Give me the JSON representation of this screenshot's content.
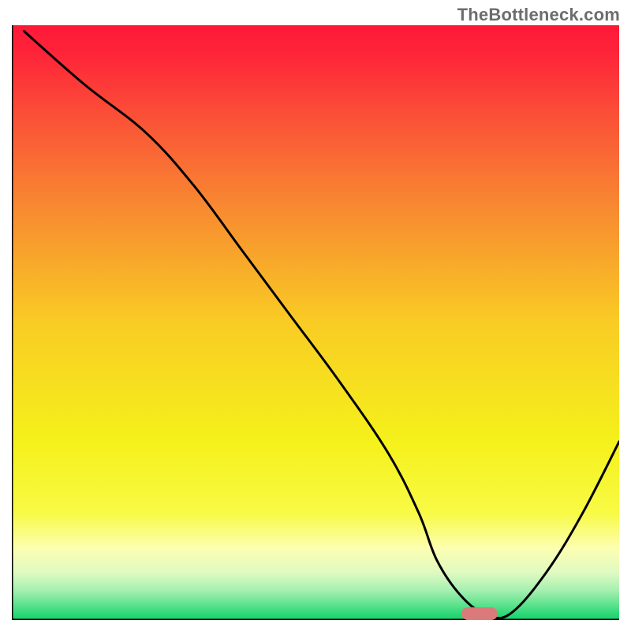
{
  "watermark": "TheBottleneck.com",
  "chart_data": {
    "type": "line",
    "title": "",
    "xlabel": "",
    "ylabel": "",
    "xlim": [
      0,
      100
    ],
    "ylim": [
      0,
      100
    ],
    "grid": false,
    "legend": false,
    "background": {
      "kind": "vertical-gradient",
      "stops": [
        {
          "offset": 0.0,
          "color": "#fe1837"
        },
        {
          "offset": 0.05,
          "color": "#fe2539"
        },
        {
          "offset": 0.15,
          "color": "#fb4f37"
        },
        {
          "offset": 0.3,
          "color": "#f88731"
        },
        {
          "offset": 0.5,
          "color": "#f9cc24"
        },
        {
          "offset": 0.7,
          "color": "#f5f11b"
        },
        {
          "offset": 0.82,
          "color": "#f8fa45"
        },
        {
          "offset": 0.88,
          "color": "#fcfeb2"
        },
        {
          "offset": 0.92,
          "color": "#e0fac1"
        },
        {
          "offset": 0.95,
          "color": "#a6f0b0"
        },
        {
          "offset": 0.975,
          "color": "#5be28d"
        },
        {
          "offset": 1.0,
          "color": "#0fd268"
        }
      ]
    },
    "series": [
      {
        "name": "curve",
        "color": "#000000",
        "width": 3,
        "x": [
          2,
          12,
          22,
          30,
          38,
          46,
          54,
          62,
          67,
          70,
          74,
          78,
          82,
          88,
          94,
          100
        ],
        "y": [
          99,
          90,
          82,
          73,
          62,
          51,
          40,
          28,
          18,
          10,
          4,
          1,
          1,
          8,
          18,
          30
        ]
      }
    ],
    "marker": {
      "name": "optimal-point",
      "x": 77,
      "y": 1,
      "color": "#db7a7b",
      "shape": "pill"
    }
  }
}
